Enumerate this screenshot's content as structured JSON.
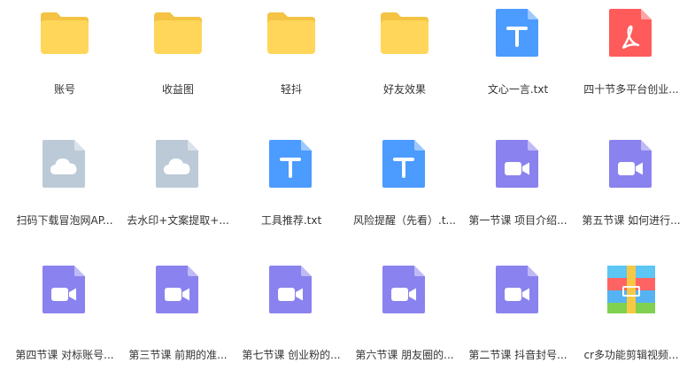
{
  "colors": {
    "folder": "#FFD659",
    "folder_tab": "#F4C343",
    "txt": "#4C9BFF",
    "pdf": "#FF5B5B",
    "video": "#8A82EE",
    "unknown": "#BCCAD7",
    "fold": "rgba(255,255,255,0.45)",
    "text": "#333333"
  },
  "files": [
    {
      "name": "账号",
      "icon": "folder-icon"
    },
    {
      "name": "收益图",
      "icon": "folder-icon"
    },
    {
      "name": "轻抖",
      "icon": "folder-icon"
    },
    {
      "name": "好友效果",
      "icon": "folder-icon"
    },
    {
      "name": "文心一言.txt",
      "icon": "txt-file-icon"
    },
    {
      "name": "四十节多平台创业...",
      "icon": "pdf-file-icon"
    },
    {
      "name": "扫码下载冒泡网AP...",
      "icon": "cloud-file-icon"
    },
    {
      "name": "去水印+文案提取+...",
      "icon": "cloud-file-icon"
    },
    {
      "name": "工具推荐.txt",
      "icon": "txt-file-icon"
    },
    {
      "name": "风险提醒（先看）.t...",
      "icon": "txt-file-icon"
    },
    {
      "name": "第一节课 项目介绍...",
      "icon": "video-file-icon"
    },
    {
      "name": "第五节课 如何进行...",
      "icon": "video-file-icon"
    },
    {
      "name": "第四节课 对标账号...",
      "icon": "video-file-icon"
    },
    {
      "name": "第三节课 前期的准...",
      "icon": "video-file-icon"
    },
    {
      "name": "第七节课 创业粉的...",
      "icon": "video-file-icon"
    },
    {
      "name": "第六节课 朋友圈的...",
      "icon": "video-file-icon"
    },
    {
      "name": "第二节课 抖音封号...",
      "icon": "video-file-icon"
    },
    {
      "name": "cr多功能剪辑视频...",
      "icon": "archive-file-icon"
    }
  ]
}
